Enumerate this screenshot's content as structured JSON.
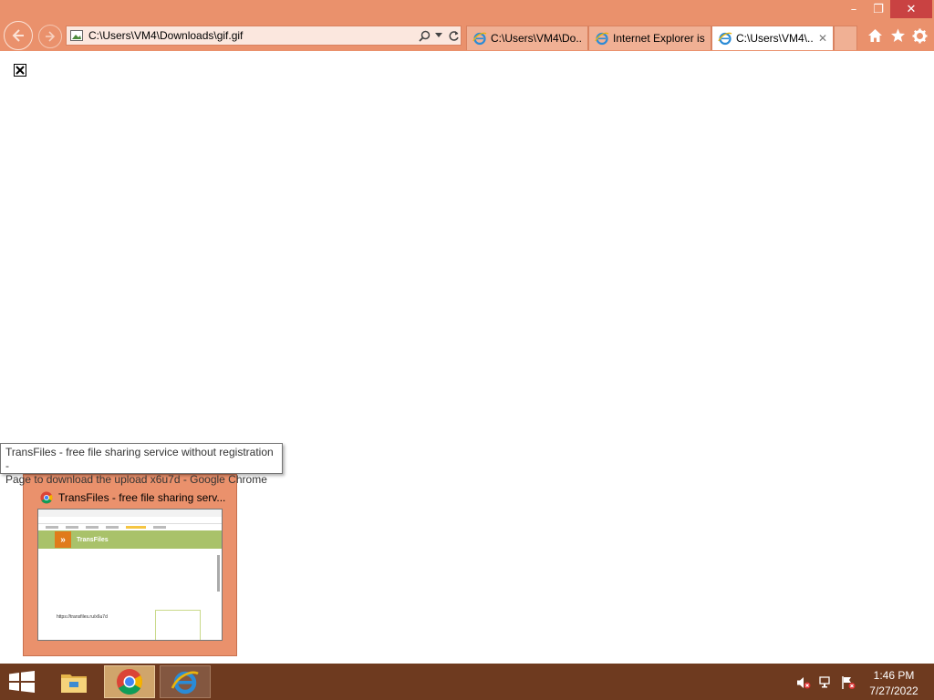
{
  "window": {
    "minimize_glyph": "–",
    "maximize_glyph": "❐",
    "close_glyph": "✕"
  },
  "address_bar": {
    "url": "C:\\Users\\VM4\\Downloads\\gif.gif",
    "search_icon": "search-icon",
    "dropdown_icon": "chevron-down-icon",
    "refresh_icon": "refresh-icon"
  },
  "tabs": [
    {
      "label": "C:\\Users\\VM4\\Do...",
      "active": false
    },
    {
      "label": "Internet Explorer is...",
      "active": false
    },
    {
      "label": "C:\\Users\\VM4\\...",
      "active": true,
      "close_glyph": "✕"
    }
  ],
  "toolbar": {
    "home_icon": "home-icon",
    "favorites_icon": "star-icon",
    "tools_icon": "gear-icon"
  },
  "page": {
    "broken_image_glyph": "✕"
  },
  "taskbar_preview": {
    "tooltip_line1": "TransFiles - free file sharing service without registration -",
    "tooltip_line2": "Page to download the upload x6u7d - Google Chrome",
    "title": "TransFiles - free file sharing serv...",
    "thumbnail": {
      "brand": "TransFiles",
      "url": "https://transfiles.ru/x6u7d"
    }
  },
  "taskbar": {
    "items": [
      {
        "name": "file-explorer"
      },
      {
        "name": "google-chrome",
        "active": true
      },
      {
        "name": "internet-explorer"
      }
    ],
    "clock_time": "1:46 PM",
    "clock_date": "7/27/2022"
  },
  "colors": {
    "chrome_accent": "#ea916c",
    "taskbar": "#6e3a1f",
    "close_button": "#c94242"
  }
}
